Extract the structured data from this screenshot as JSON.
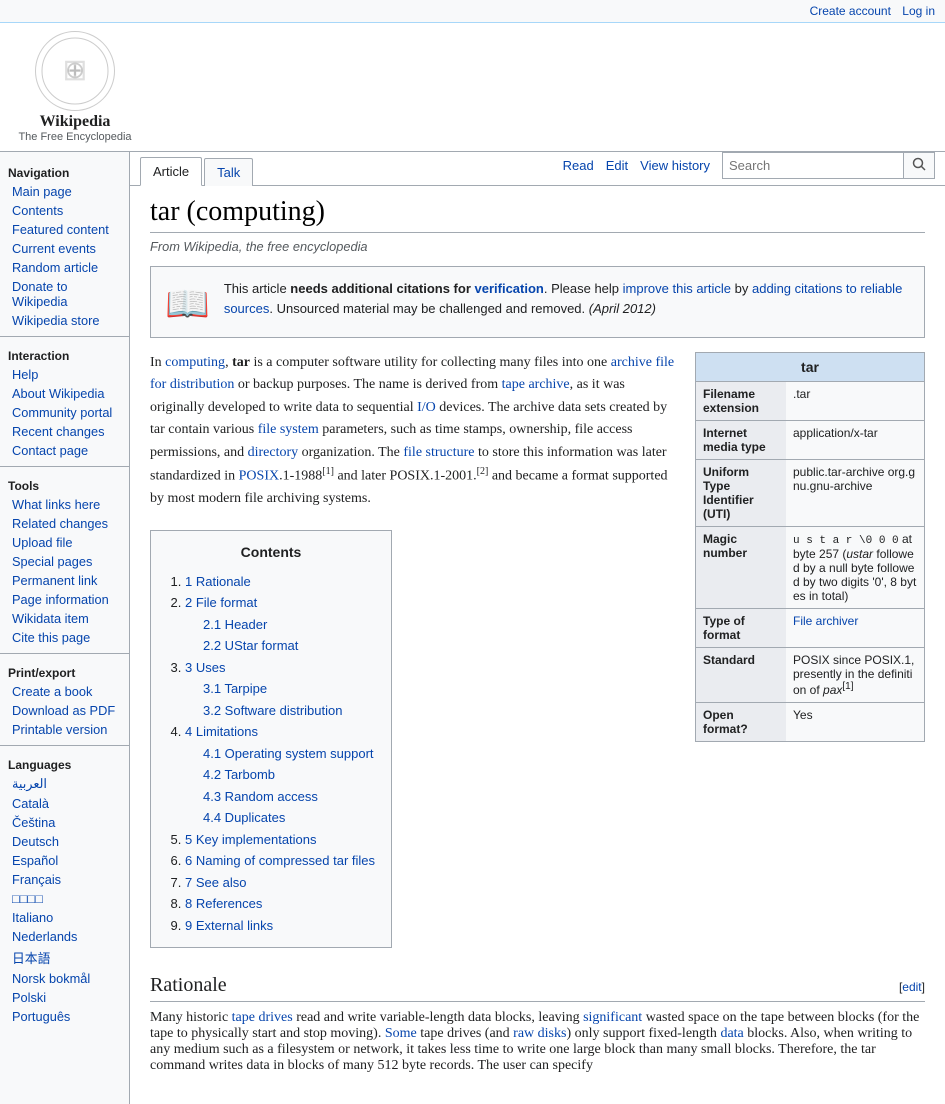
{
  "topbar": {
    "create_account": "Create account",
    "log_in": "Log in"
  },
  "logo": {
    "icon": "🌐",
    "title": "Wikipedia",
    "subtitle": "The Free Encyclopedia"
  },
  "tabs": {
    "article": "Article",
    "talk": "Talk",
    "read": "Read",
    "edit": "Edit",
    "view_history": "View history"
  },
  "search": {
    "placeholder": "Search",
    "button": "🔍"
  },
  "sidebar": {
    "navigation_title": "Navigation",
    "items_navigation": [
      "Main page",
      "Contents",
      "Featured content",
      "Current events",
      "Random article",
      "Donate to Wikipedia",
      "Wikipedia store"
    ],
    "interaction_title": "Interaction",
    "items_interaction": [
      "Help",
      "About Wikipedia",
      "Community portal",
      "Recent changes",
      "Contact page"
    ],
    "tools_title": "Tools",
    "items_tools": [
      "What links here",
      "Related changes",
      "Upload file",
      "Special pages",
      "Permanent link",
      "Page information",
      "Wikidata item",
      "Cite this page"
    ],
    "print_title": "Print/export",
    "items_print": [
      "Create a book",
      "Download as PDF",
      "Printable version"
    ],
    "languages_title": "Languages",
    "items_languages": [
      "العربية",
      "Català",
      "Čeština",
      "Deutsch",
      "Español",
      "Français",
      "□□□□",
      "Italiano",
      "Nederlands",
      "日本語",
      "Norsk bokmål",
      "Polski",
      "Português"
    ]
  },
  "article": {
    "title": "tar (computing)",
    "subtitle": "From Wikipedia, the free encyclopedia",
    "citation_box": {
      "icon": "📖",
      "text_start": "This article ",
      "needs_text": "needs additional citations for ",
      "verification": "verification",
      "text_mid": ". Please help ",
      "improve_link": "improve this article",
      "text_by": " by ",
      "adding_link": "adding citations to reliable sources",
      "text_end": ". Unsourced material may be challenged and removed.",
      "date": "(April 2012)"
    },
    "infobox": {
      "title": "tar",
      "rows": [
        {
          "label": "Filename extension",
          "value": ".tar"
        },
        {
          "label": "Internet media type",
          "value": "application/x-tar"
        },
        {
          "label": "Uniform Type Identifier (UTI)",
          "value": "public.tar-archive org.gnu.gnu-archive"
        },
        {
          "label": "Magic number",
          "value": "u s t a r \\0 0 0 at byte 257 (ustar followed by a null byte followed by two digits '0', 8 bytes in total)"
        },
        {
          "label": "Type of format",
          "value": "File archiver"
        },
        {
          "label": "Standard",
          "value": "POSIX since POSIX.1, presently in the definition of pax[1]"
        },
        {
          "label": "Open format?",
          "value": "Yes"
        }
      ]
    },
    "intro": "In computing, tar is a computer software utility for collecting many files into one archive file for distribution or backup purposes. The name is derived from tape archive, as it was originally developed to write data to sequential I/O devices. The archive data sets created by tar contain various file system parameters, such as time stamps, ownership, file access permissions, and directory organization. The file structure to store this information was later standardized in POSIX.1-1988[1] and later POSIX.1-2001.[2] and became a format supported by most modern file archiving systems.",
    "contents": {
      "title": "Contents",
      "items": [
        {
          "num": "1",
          "label": "Rationale",
          "sub": []
        },
        {
          "num": "2",
          "label": "File format",
          "sub": [
            {
              "num": "2.1",
              "label": "Header"
            },
            {
              "num": "2.2",
              "label": "UStar format"
            }
          ]
        },
        {
          "num": "3",
          "label": "Uses",
          "sub": [
            {
              "num": "3.1",
              "label": "Tarpipe"
            },
            {
              "num": "3.2",
              "label": "Software distribution"
            }
          ]
        },
        {
          "num": "4",
          "label": "Limitations",
          "sub": [
            {
              "num": "4.1",
              "label": "Operating system support"
            },
            {
              "num": "4.2",
              "label": "Tarbomb"
            },
            {
              "num": "4.3",
              "label": "Random access"
            },
            {
              "num": "4.4",
              "label": "Duplicates"
            }
          ]
        },
        {
          "num": "5",
          "label": "Key implementations",
          "sub": []
        },
        {
          "num": "6",
          "label": "Naming of compressed tar files",
          "sub": []
        },
        {
          "num": "7",
          "label": "See also",
          "sub": []
        },
        {
          "num": "8",
          "label": "References",
          "sub": []
        },
        {
          "num": "9",
          "label": "External links",
          "sub": []
        }
      ]
    },
    "rationale_heading": "Rationale",
    "rationale_edit": "[edit]",
    "rationale_text": "Many historic tape drives read and write variable-length data blocks, leaving significant wasted space on the tape between blocks (for the tape to physically start and stop moving). Some tape drives (and raw disks) only support fixed-length data blocks. Also, when writing to any medium such as a filesystem or network, it takes less time to write one large block than many small blocks. Therefore, the tar command writes data in blocks of many 512 byte records. The user can specify"
  }
}
